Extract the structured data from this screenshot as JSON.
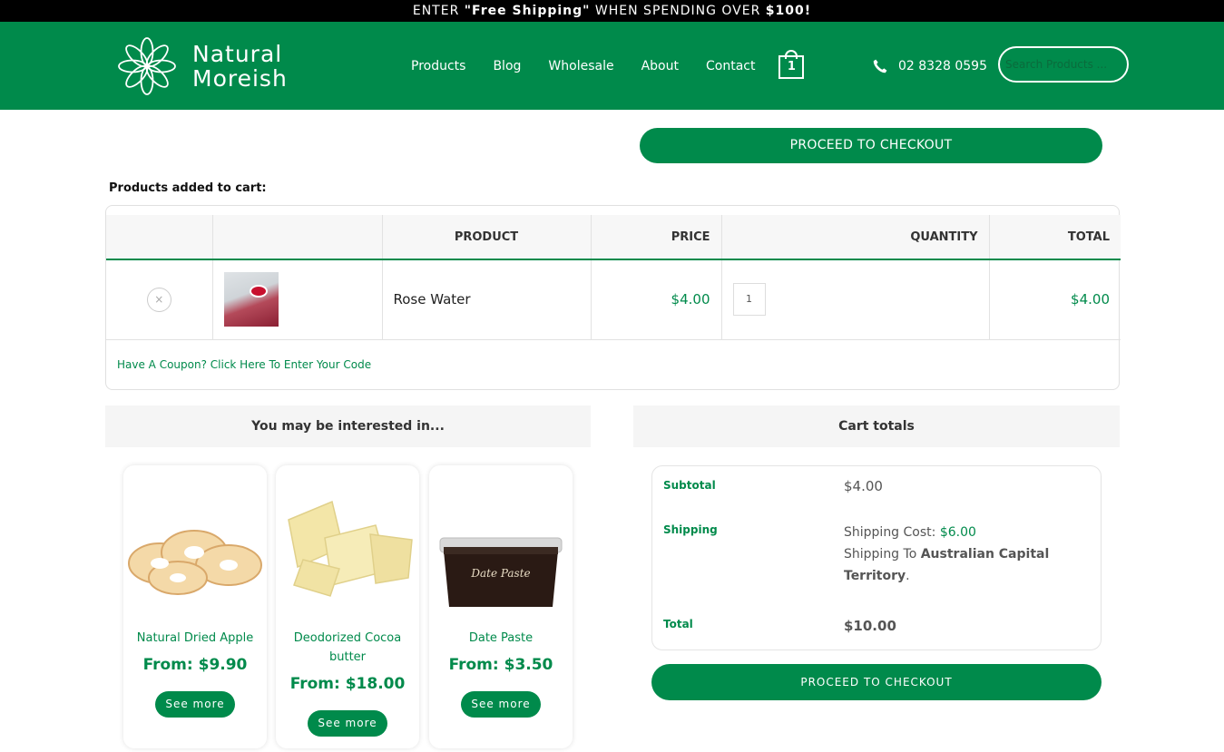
{
  "promo": {
    "prefix": "ENTER ",
    "code": "\"Free Shipping\"",
    "middle": " WHEN SPENDING OVER ",
    "amount": "$100!"
  },
  "header": {
    "logo_line1": "Natural",
    "logo_line2": "Moreish",
    "nav": [
      "Products",
      "Blog",
      "Wholesale",
      "About",
      "Contact"
    ],
    "cart_count": "1",
    "phone": "02 8328 0595",
    "search_placeholder": "Search Products ..."
  },
  "checkout_top_label": "PROCEED TO CHECKOUT",
  "cart": {
    "label": "Products added to cart:",
    "columns": [
      "",
      "",
      "PRODUCT",
      "PRICE",
      "QUANTITY",
      "TOTAL"
    ],
    "rows": [
      {
        "remove": "×",
        "product": "Rose Water",
        "price": "$4.00",
        "quantity": "1",
        "total": "$4.00"
      }
    ],
    "coupon_link": "Have A Coupon? Click Here To Enter Your Code"
  },
  "interested": {
    "title": "You may be interested in...",
    "products": [
      {
        "name": "Natural Dried Apple",
        "price": "From: $9.90",
        "button": "See more"
      },
      {
        "name": "Deodorized Cocoa butter",
        "price": "From: $18.00",
        "button": "See more"
      },
      {
        "name": "Date Paste",
        "price": "From: $3.50",
        "button": "See more",
        "jar_label": "Date Paste"
      }
    ]
  },
  "totals": {
    "title": "Cart totals",
    "subtotal_label": "Subtotal",
    "subtotal_value": "$4.00",
    "shipping_label": "Shipping",
    "shipping_cost_label": "Shipping Cost: ",
    "shipping_cost_value": "$6.00",
    "shipping_to_label": "Shipping To ",
    "shipping_to_value": "Australian Capital Territory",
    "total_label": "Total",
    "total_value": "$10.00",
    "checkout_label": "PROCEED TO CHECKOUT"
  },
  "colors": {
    "brand_green": "#008a4b",
    "promo_bg": "#000000"
  }
}
